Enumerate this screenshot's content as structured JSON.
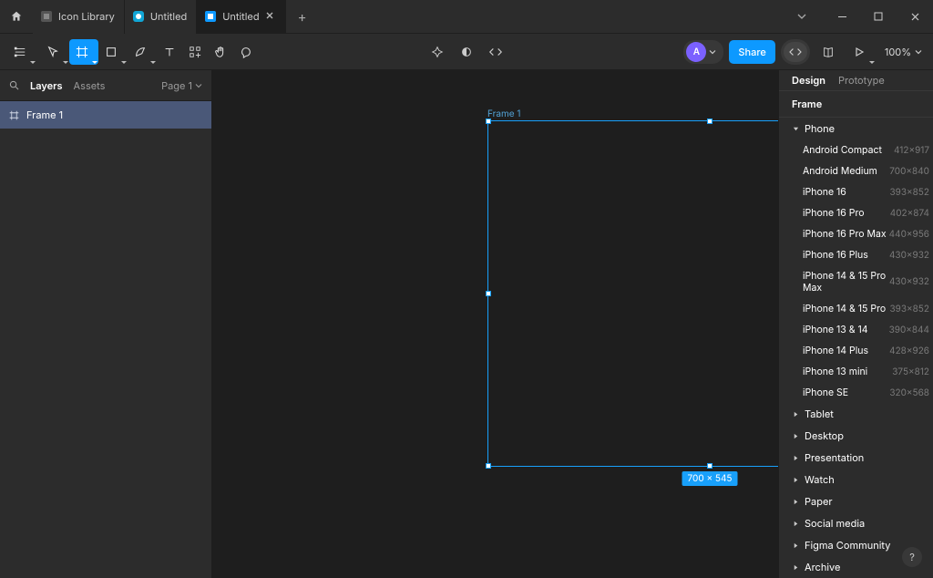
{
  "tabs": [
    {
      "label": "Icon Library",
      "kind": "design",
      "active": false
    },
    {
      "label": "Untitled",
      "kind": "figjam",
      "active": false
    },
    {
      "label": "Untitled",
      "kind": "design",
      "active": true
    }
  ],
  "toolbar": {
    "share_label": "Share",
    "zoom_label": "100%",
    "avatar_letter": "A"
  },
  "left_panel": {
    "layers_tab": "Layers",
    "assets_tab": "Assets",
    "page_label": "Page 1",
    "layers": [
      {
        "name": "Frame 1"
      }
    ]
  },
  "canvas": {
    "frame_label": "Frame 1",
    "size_badge": "700 × 545"
  },
  "right_panel": {
    "tabs": {
      "design": "Design",
      "prototype": "Prototype"
    },
    "section_title": "Frame",
    "groups": [
      {
        "name": "Phone",
        "expanded": true,
        "items": [
          {
            "name": "Android Compact",
            "dims": "412×917"
          },
          {
            "name": "Android Medium",
            "dims": "700×840"
          },
          {
            "name": "iPhone 16",
            "dims": "393×852"
          },
          {
            "name": "iPhone 16 Pro",
            "dims": "402×874"
          },
          {
            "name": "iPhone 16 Pro Max",
            "dims": "440×956"
          },
          {
            "name": "iPhone 16 Plus",
            "dims": "430×932"
          },
          {
            "name": "iPhone 14 & 15 Pro Max",
            "dims": "430×932"
          },
          {
            "name": "iPhone 14 & 15 Pro",
            "dims": "393×852"
          },
          {
            "name": "iPhone 13 & 14",
            "dims": "390×844"
          },
          {
            "name": "iPhone 14 Plus",
            "dims": "428×926"
          },
          {
            "name": "iPhone 13 mini",
            "dims": "375×812"
          },
          {
            "name": "iPhone SE",
            "dims": "320×568"
          }
        ]
      },
      {
        "name": "Tablet",
        "expanded": false
      },
      {
        "name": "Desktop",
        "expanded": false
      },
      {
        "name": "Presentation",
        "expanded": false
      },
      {
        "name": "Watch",
        "expanded": false
      },
      {
        "name": "Paper",
        "expanded": false
      },
      {
        "name": "Social media",
        "expanded": false
      },
      {
        "name": "Figma Community",
        "expanded": false
      },
      {
        "name": "Archive",
        "expanded": false
      }
    ]
  }
}
